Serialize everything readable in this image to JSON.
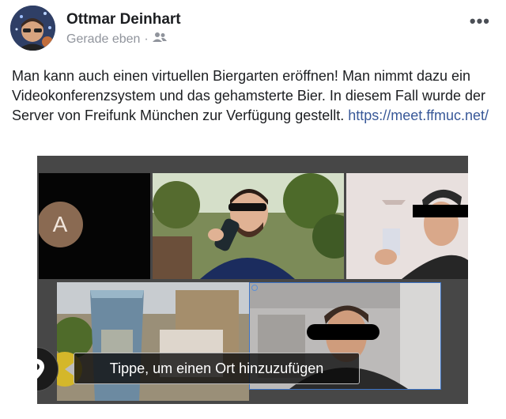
{
  "post": {
    "author": "Ottmar Deinhart",
    "time": "Gerade eben",
    "separator": "·",
    "audience_icon": "friends-icon",
    "more_label": "•••",
    "text": "Man kann auch einen virtuellen Biergarten eröffnen! Man nimmt dazu ein Videokonferenzsystem und das gehamsterte Bier. In diesem Fall wurde der Server von Freifunk München zur Verfügung gestellt. ",
    "link": "https://meet.ffmuc.net/"
  },
  "media": {
    "tiles": [
      {
        "id": "a",
        "avatar_letter": "A"
      },
      {
        "id": "b"
      },
      {
        "id": "c"
      },
      {
        "id": "d"
      },
      {
        "id": "e"
      }
    ],
    "location_icon": "location-pin-icon",
    "location_prompt": "Tippe, um einen Ort hinzuzufügen"
  },
  "colors": {
    "link": "#385898",
    "meta": "#90949c",
    "media_bg": "#474747"
  }
}
